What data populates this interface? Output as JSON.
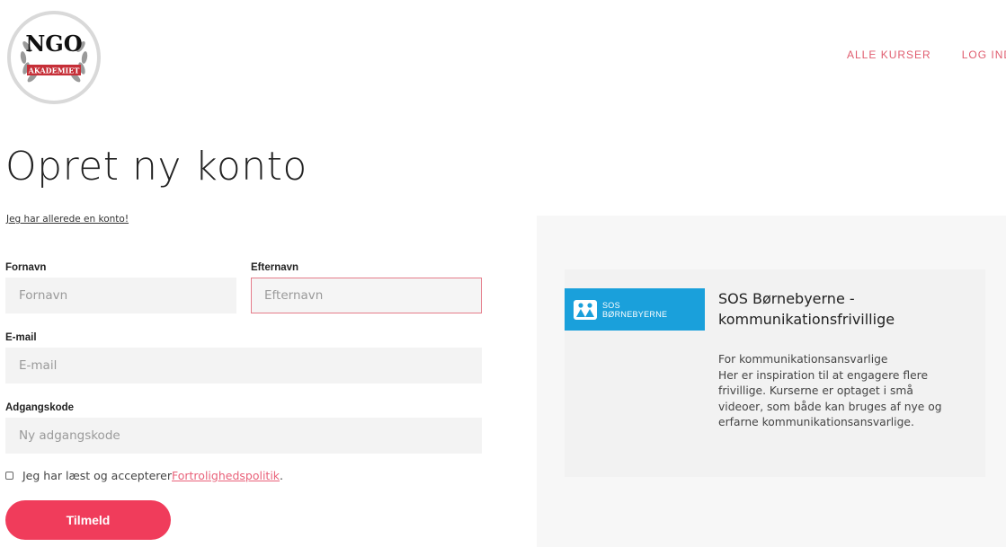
{
  "logo": {
    "letters": "NGO",
    "banner": "AKADEMIET"
  },
  "nav": {
    "all_courses": "ALLE KURSER",
    "login": "LOG IND"
  },
  "page": {
    "title": "Opret ny konto",
    "existing_account_link": "Jeg har allerede en konto!"
  },
  "form": {
    "first_name": {
      "label": "Fornavn",
      "placeholder": "Fornavn",
      "value": ""
    },
    "last_name": {
      "label": "Efternavn",
      "placeholder": "Efternavn",
      "value": ""
    },
    "email": {
      "label": "E-mail",
      "placeholder": "E-mail",
      "value": ""
    },
    "password": {
      "label": "Adgangskode",
      "placeholder": "Ny adgangskode",
      "value": ""
    },
    "consent": {
      "text": "Jeg har læst og accepterer ",
      "link": "Fortrolighedspolitik",
      "suffix": ".",
      "checked": false
    },
    "submit_label": "Tilmeld"
  },
  "course": {
    "logo_text_1": "SOS",
    "logo_text_2": "BØRNEBYERNE",
    "title": "SOS Børnebyerne - kommunikationsfrivillige",
    "description": "For kommunikationsansvarlige\nHer er inspiration til at engagere flere frivillige. Kurserne er optaget i små videoer, som både kan bruges af nye og erfarne kommunikationsansvarlige."
  },
  "colors": {
    "accent": "#f03c5b",
    "nav": "#e05d6f",
    "error_border": "#e57c8a",
    "sos_blue": "#1aa0db"
  },
  "icons": {
    "logo": "ngo-akademiet-laurel-logo",
    "sos": "sos-children-icon"
  }
}
